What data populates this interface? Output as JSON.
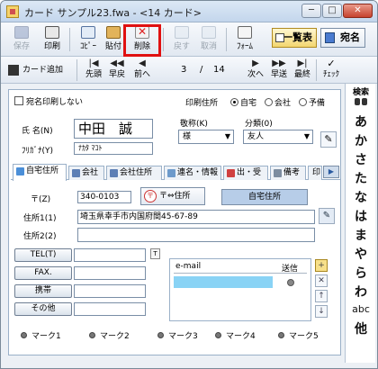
{
  "window": {
    "title": "カード サンプル23.fwa - <14 カード>",
    "minimize": "─",
    "maximize": "□",
    "close": "✕"
  },
  "toolbar": {
    "save": "保存",
    "print": "印刷",
    "copy": "ｺﾋﾟｰ",
    "paste": "貼付",
    "delete": "削除",
    "undo": "戻す",
    "cancel": "取消",
    "form": "ﾌｫｰﾑ",
    "list_view": "一覧表",
    "address": "宛名"
  },
  "navbar": {
    "add_card": "カード追加",
    "first": "先頭",
    "fast_back": "早戻",
    "prev": "前へ",
    "page_current": "3",
    "page_sep": "/",
    "page_total": "14",
    "next": "次へ",
    "fast_forward": "早送",
    "last": "最終",
    "check": "ﾁｪｯｸ",
    "first_arrow": "|◀",
    "fast_back_arrow": "◀◀",
    "prev_arrow": "◀",
    "next_arrow": "▶",
    "fast_forward_arrow": "▶▶",
    "last_arrow": "▶|",
    "check_icon": "✓"
  },
  "card": {
    "no_print_label": "宛名印刷しない",
    "print_addr_label": "印刷住所",
    "radio_home": "自宅",
    "radio_company": "会社",
    "radio_reserve": "予備",
    "name_label": "氏 名(N)",
    "name_value": "中田　誠",
    "kana_label": "ﾌﾘｶﾞﾅ(Y)",
    "kana_value": "ﾅｶﾀ ﾏｺﾄ",
    "honorific_label": "敬称(K)",
    "honorific_value": "様",
    "category_label": "分類(0)",
    "category_value": "友人",
    "pencil": "✎"
  },
  "tabs": [
    "自宅住所",
    "会社",
    "会社住所",
    "連名・情報",
    "出・受",
    "備考",
    "印"
  ],
  "tab_scroll": "▶",
  "address": {
    "zip_label": "〒(Z)",
    "zip_value": "340-0103",
    "zip_button": "〒⇔住所",
    "zip_icon": "〒",
    "home_address_button": "自宅住所",
    "addr1_label": "住所1(1)",
    "addr1_value": "埼玉県幸手市内国府間45-67-89",
    "addr2_label": "住所2(2)",
    "edit_icon": "✎"
  },
  "contacts": {
    "tel": "TEL(T)",
    "fax": "FAX.",
    "mobile": "携帯",
    "other": "その他",
    "tel_mini": "T"
  },
  "email": {
    "header_email": "e-mail",
    "header_send": "送信",
    "add": "+",
    "delete": "✕",
    "up": "↑",
    "down": "↓"
  },
  "marks": [
    "マーク1",
    "マーク2",
    "マーク3",
    "マーク4",
    "マーク5"
  ],
  "search": {
    "title": "検索",
    "kana": [
      "あ",
      "か",
      "さ",
      "た",
      "な",
      "は",
      "ま",
      "や",
      "ら",
      "わ",
      "abc",
      "他"
    ]
  }
}
